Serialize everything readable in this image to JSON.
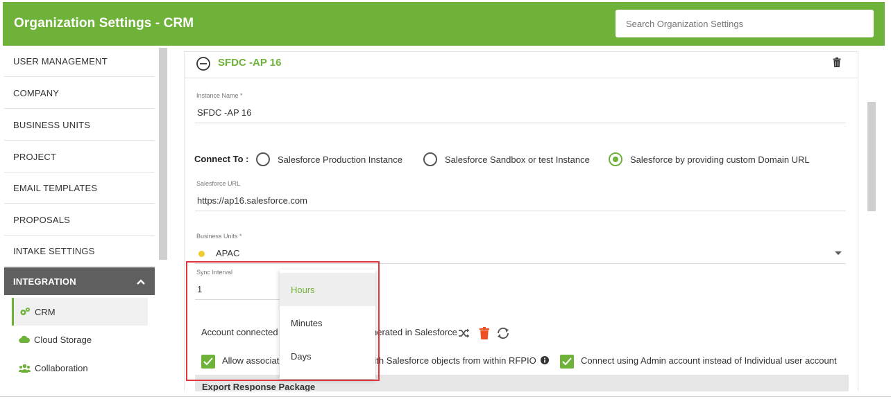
{
  "header": {
    "title": "Organization Settings - CRM",
    "search_placeholder": "Search Organization Settings"
  },
  "sidebar": {
    "items": [
      {
        "label": "USER MANAGEMENT"
      },
      {
        "label": "COMPANY"
      },
      {
        "label": "BUSINESS UNITS"
      },
      {
        "label": "PROJECT"
      },
      {
        "label": "EMAIL TEMPLATES"
      },
      {
        "label": "PROPOSALS"
      },
      {
        "label": "INTAKE SETTINGS"
      },
      {
        "label": "INTEGRATION"
      }
    ],
    "sub_items": [
      {
        "label": "CRM",
        "icon": "gears-icon"
      },
      {
        "label": "Cloud Storage",
        "icon": "cloud-icon"
      },
      {
        "label": "Collaboration",
        "icon": "users-icon"
      }
    ]
  },
  "instance": {
    "title": "SFDC -AP 16",
    "instance_name_label": "Instance Name *",
    "instance_name_value": "SFDC -AP 16",
    "connect_to_label": "Connect To :",
    "connect_options": [
      "Salesforce Production Instance",
      "Salesforce Sandbox or test Instance",
      "Salesforce by providing custom Domain URL"
    ],
    "selected_connect_option": "Salesforce by providing custom Domain URL",
    "salesforce_url_label": "Salesforce URL",
    "salesforce_url_value": "https://ap16.salesforce.com",
    "business_units_label": "Business Units *",
    "business_units_value": "APAC",
    "sync_interval_label": "Sync Interval",
    "sync_interval_value": "1",
    "account_text_left": "Account connected",
    "account_text_right": "nerated in Salesforce",
    "allow_text_left": "Allow associat",
    "allow_text_right": "with Salesforce objects from within RFPIO",
    "admin_text": "Connect using Admin account instead of Individual user account",
    "grey_bar_text": "Export Response Package"
  },
  "dropdown": {
    "options": [
      "Hours",
      "Minutes",
      "Days"
    ],
    "selected": "Hours"
  },
  "colors": {
    "brand_green": "#6fb23a",
    "sidebar_active": "#5f5f5f",
    "highlight_red": "#e0363c",
    "delete_orange": "#f04e23"
  }
}
